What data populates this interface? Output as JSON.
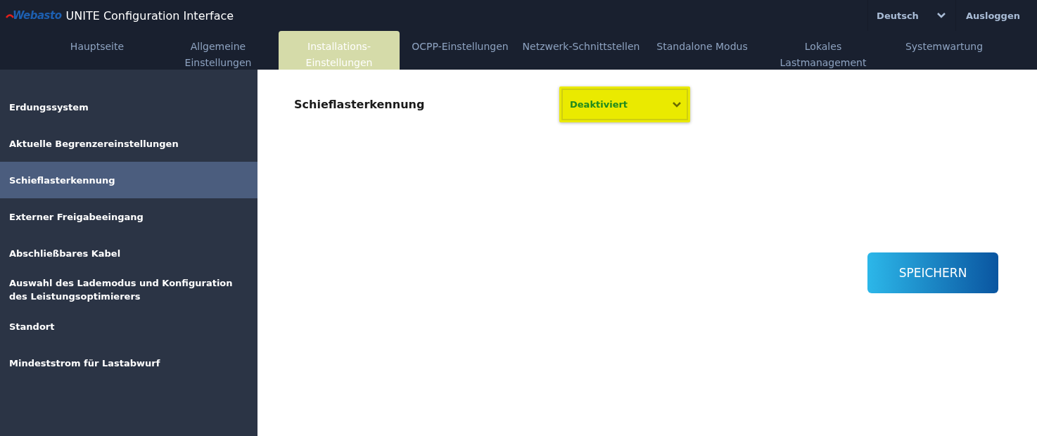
{
  "header": {
    "logo": "Webasto",
    "title": "UNITE Configuration Interface",
    "language": "Deutsch",
    "logout": "Ausloggen"
  },
  "tabs": [
    {
      "label": "Hauptseite",
      "selected": false
    },
    {
      "label": "Allgemeine Einstellungen",
      "selected": false
    },
    {
      "label": "Installations-Einstellungen",
      "selected": true
    },
    {
      "label": "OCPP-Einstellungen",
      "selected": false
    },
    {
      "label": "Netzwerk-Schnittstellen",
      "selected": false
    },
    {
      "label": "Standalone Modus",
      "selected": false
    },
    {
      "label": "Lokales Lastmanagement",
      "selected": false
    },
    {
      "label": "Systemwartung",
      "selected": false
    }
  ],
  "sidebar": {
    "items": [
      {
        "label": "Erdungssystem",
        "selected": false
      },
      {
        "label": "Aktuelle Begrenzereinstellungen",
        "selected": false
      },
      {
        "label": "Schieflasterkennung",
        "selected": true
      },
      {
        "label": "Externer Freigabeeingang",
        "selected": false
      },
      {
        "label": "Abschließbares Kabel",
        "selected": false
      },
      {
        "label": "Auswahl des Lademodus und Konfiguration des Leistungsoptimierers",
        "selected": false
      },
      {
        "label": "Standort",
        "selected": false
      },
      {
        "label": "Mindeststrom für Lastabwurf",
        "selected": false
      }
    ]
  },
  "form": {
    "label": "Schieflasterkennung",
    "value": "Deaktiviert",
    "save": "SPEICHERN"
  }
}
